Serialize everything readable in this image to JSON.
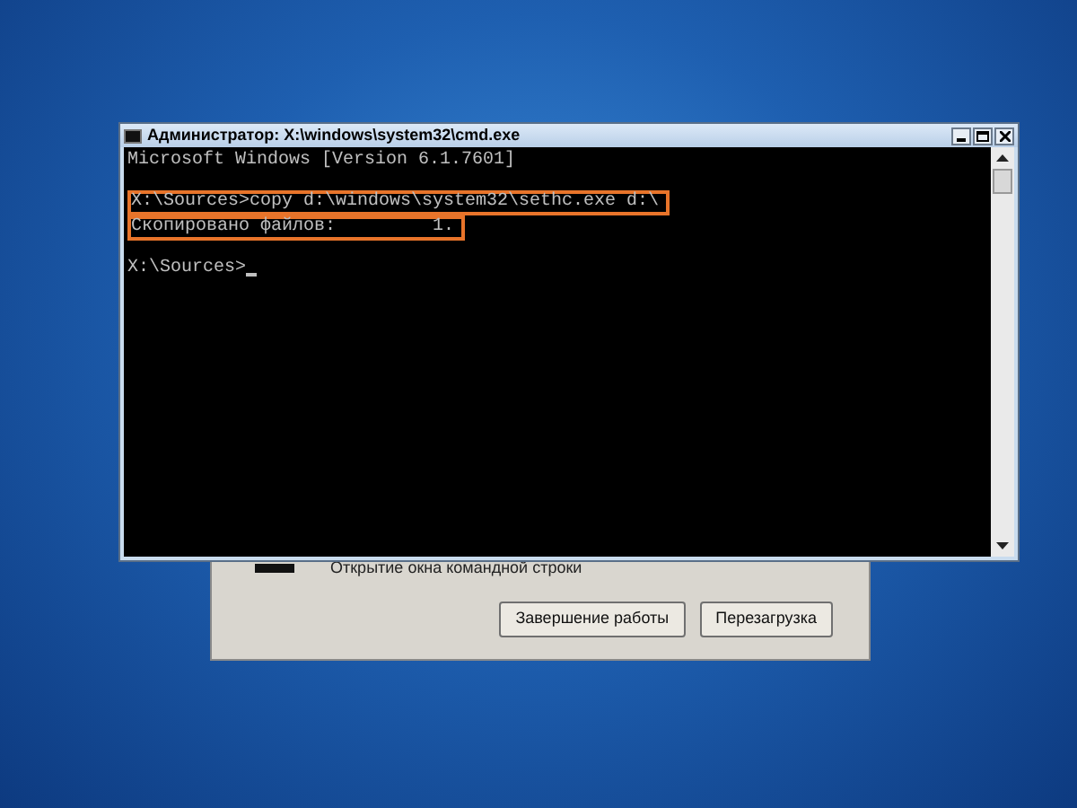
{
  "dialog": {
    "caption": "Открытие окна командной строки",
    "buttons": [
      {
        "label": "Завершение работы"
      },
      {
        "label": "Перезагрузка"
      }
    ]
  },
  "cmd_window": {
    "title": "Администратор: X:\\windows\\system32\\cmd.exe",
    "blocks": [
      {
        "highlighted": false,
        "lines": [
          "Microsoft Windows [Version 6.1.7601]"
        ]
      },
      {
        "highlighted": true,
        "lines": [
          "X:\\Sources>copy d:\\windows\\system32\\sethc.exe d:\\",
          "Скопировано файлов:         1."
        ]
      },
      {
        "highlighted": false,
        "lines": [
          "X:\\Sources>"
        ],
        "cursor": true
      }
    ]
  }
}
